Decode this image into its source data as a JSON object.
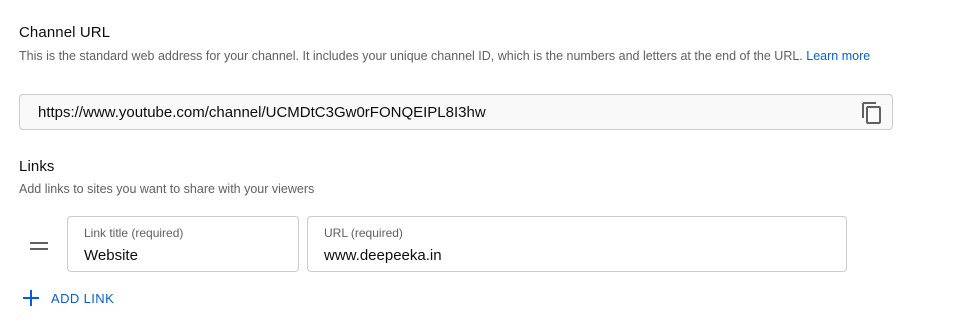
{
  "channel_url": {
    "title": "Channel URL",
    "description": "This is the standard web address for your channel. It includes your unique channel ID, which is the numbers and letters at the end of the URL.",
    "learn_more": "Learn more",
    "value": "https://www.youtube.com/channel/UCMDtC3Gw0rFONQEIPL8I3hw",
    "copy_icon": "copy-icon"
  },
  "links": {
    "title": "Links",
    "description": "Add links to sites you want to share with your viewers",
    "items": [
      {
        "title_label": "Link title (required)",
        "title_value": "Website",
        "url_label": "URL (required)",
        "url_value": "www.deepeeka.in"
      }
    ],
    "add_link_label": "ADD LINK"
  },
  "colors": {
    "accent": "#065fd4",
    "text_primary": "#0d0d0d",
    "text_secondary": "#606060",
    "border": "#cccccc",
    "field_readonly_bg": "#f9f9f9"
  }
}
